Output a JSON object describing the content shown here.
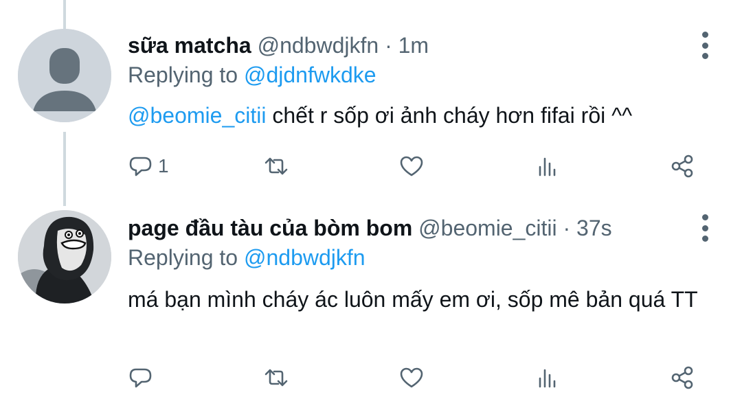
{
  "tweets": [
    {
      "author_name": "sữa matcha",
      "handle": "@ndbwdjkfn",
      "separator": "·",
      "time": "1m",
      "replying_prefix": "Replying to",
      "replying_to": "@djdnfwkdke",
      "mention": "@beomie_citii",
      "text": " chết r sốp ơi ảnh cháy hơn fifai rồi ^^",
      "reply_count": "1",
      "avatar": "default-avatar"
    },
    {
      "author_name": "page đầu tàu của bòm bom",
      "handle": "@beomie_citii",
      "separator": "·",
      "time": "37s",
      "replying_prefix": "Replying to",
      "replying_to": "@ndbwdjkfn",
      "text": "má bạn mình cháy ác luôn mấy em ơi, sốp mê bản quá TT",
      "reply_count": "",
      "avatar": "profile-photo"
    }
  ],
  "icons": [
    "more-vertical-icon",
    "reply-icon",
    "retweet-icon",
    "like-icon",
    "analytics-icon",
    "share-icon"
  ],
  "colors": {
    "link": "#1d9bf0",
    "secondary": "#536471",
    "primary": "#0f1419",
    "thread_line": "#cfd9de"
  }
}
